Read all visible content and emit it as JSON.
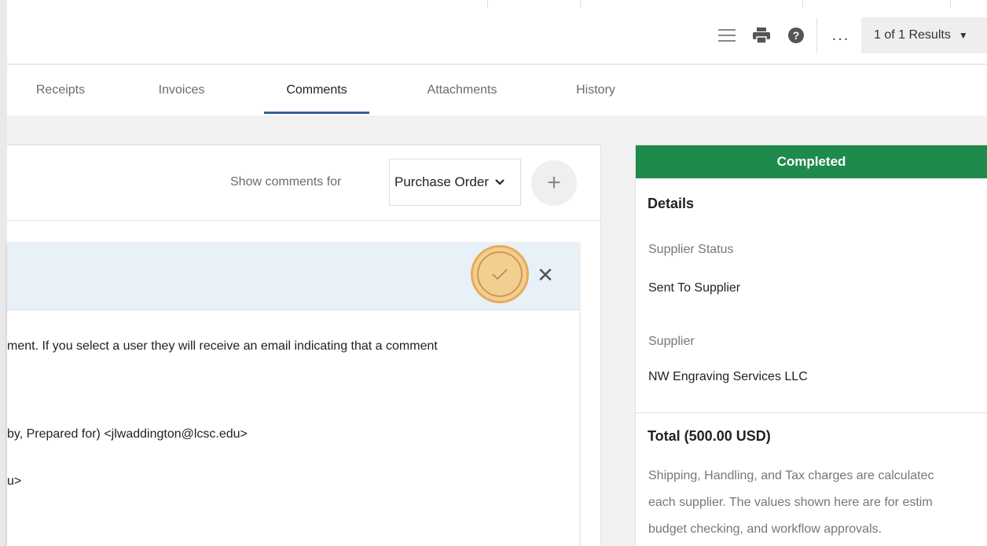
{
  "toolbar": {
    "results_label": "1 of 1 Results",
    "more_label": "..."
  },
  "tabs": [
    {
      "label": "Receipts"
    },
    {
      "label": "Invoices"
    },
    {
      "label": "Comments"
    },
    {
      "label": "Attachments"
    },
    {
      "label": "History"
    }
  ],
  "comments": {
    "show_label": "Show comments for",
    "select_value": "Purchase Order",
    "add_symbol": "+",
    "close_symbol": "✕",
    "text_lines": [
      "ment. If you select a user they will receive an email indicating that a comment",
      "by, Prepared for) <jlwaddington@lcsc.edu>",
      "u>"
    ]
  },
  "side": {
    "status": "Completed",
    "details_heading": "Details",
    "supplier_status_label": "Supplier Status",
    "supplier_status_value": "Sent To Supplier",
    "supplier_label": "Supplier",
    "supplier_value": "NW Engraving Services LLC",
    "total_heading": "Total (500.00 USD)",
    "note_lines": [
      "Shipping, Handling, and Tax charges are calculatec",
      "each supplier. The values shown here are for estim",
      "budget checking, and workflow approvals."
    ]
  },
  "colors": {
    "status_green": "#1e8a4c",
    "tab_underline": "#3b5da0",
    "highlight": "#f3cf8f"
  }
}
